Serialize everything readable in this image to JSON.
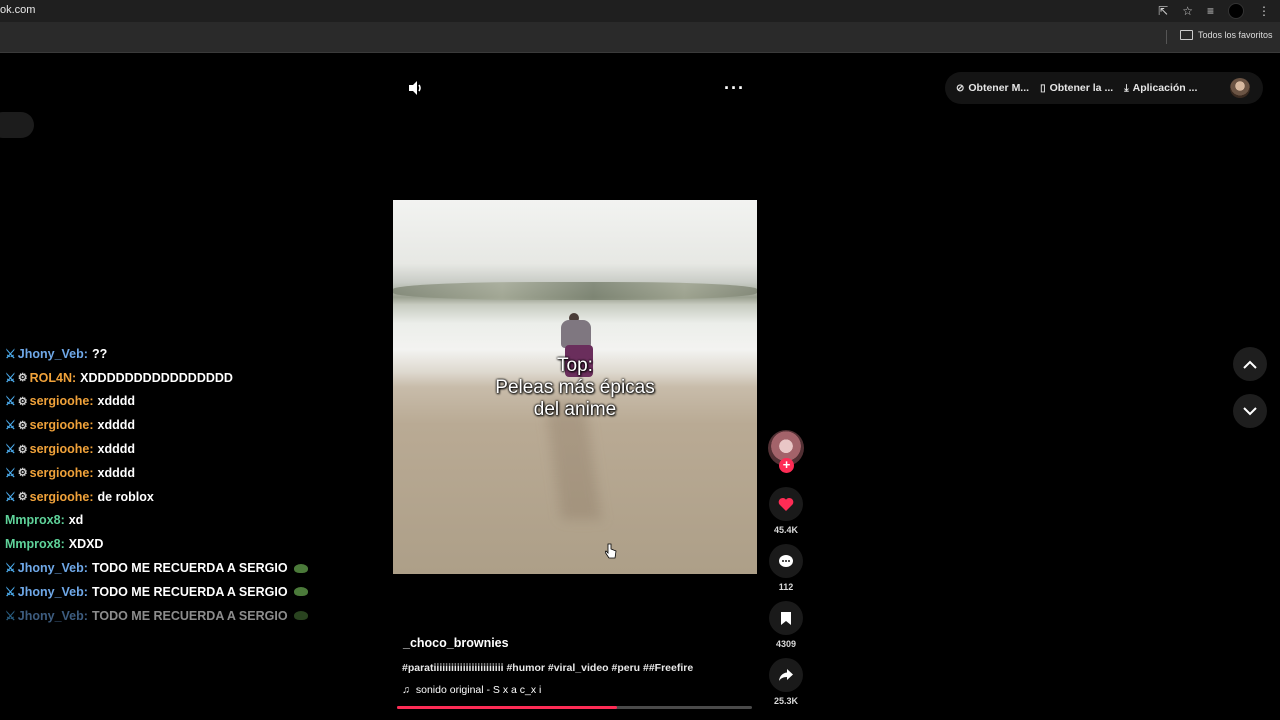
{
  "browser": {
    "url": "ok.com",
    "bookmark_folder": "Todos los favoritos"
  },
  "top_actions": [
    {
      "icon": "coin-icon",
      "label": "Obtener M..."
    },
    {
      "icon": "phone-icon",
      "label": "Obtener la ..."
    },
    {
      "icon": "download-icon",
      "label": "Aplicación ..."
    }
  ],
  "video": {
    "caption": [
      "Top:",
      "Peleas más épicas",
      "del anime"
    ],
    "progress_fraction": 0.62
  },
  "actions": {
    "likes": "45.4K",
    "comments": "112",
    "saves": "4309",
    "shares": "25.3K"
  },
  "post": {
    "author": "_choco_brownies",
    "description": "#paratiiiiiiiiiiiiiiiiiiiiiiii #humor #viral_video #peru ##Freefire",
    "sound": "sonido original - S x a c_x i"
  },
  "chat": [
    {
      "user": "Jhony_Veb:",
      "msg": "??",
      "color": "#6fa8e8",
      "badges": [
        "sword"
      ],
      "emote": false,
      "faded": false
    },
    {
      "user": "ROL4N:",
      "msg": "XDDDDDDDDDDDDDDDD",
      "color": "#f0a23a",
      "badges": [
        "sword",
        "globe"
      ],
      "emote": false,
      "faded": false
    },
    {
      "user": "sergioohe:",
      "msg": "xdddd",
      "color": "#f0a23a",
      "badges": [
        "sword",
        "globe"
      ],
      "emote": false,
      "faded": false
    },
    {
      "user": "sergioohe:",
      "msg": "xdddd",
      "color": "#f0a23a",
      "badges": [
        "sword",
        "globe"
      ],
      "emote": false,
      "faded": false
    },
    {
      "user": "sergioohe:",
      "msg": "xdddd",
      "color": "#f0a23a",
      "badges": [
        "sword",
        "globe"
      ],
      "emote": false,
      "faded": false
    },
    {
      "user": "sergioohe:",
      "msg": "xdddd",
      "color": "#f0a23a",
      "badges": [
        "sword",
        "globe"
      ],
      "emote": false,
      "faded": false
    },
    {
      "user": "sergioohe:",
      "msg": "de roblox",
      "color": "#f0a23a",
      "badges": [
        "sword",
        "globe"
      ],
      "emote": false,
      "faded": false
    },
    {
      "user": "Mmprox8:",
      "msg": "xd",
      "color": "#5fd39a",
      "badges": [],
      "emote": false,
      "faded": false
    },
    {
      "user": "Mmprox8:",
      "msg": "XDXD",
      "color": "#5fd39a",
      "badges": [],
      "emote": false,
      "faded": false
    },
    {
      "user": "Jhony_Veb:",
      "msg": "TODO ME RECUERDA A SERGIO",
      "color": "#6fa8e8",
      "badges": [
        "sword"
      ],
      "emote": true,
      "faded": false
    },
    {
      "user": "Jhony_Veb:",
      "msg": "TODO ME RECUERDA A SERGIO",
      "color": "#6fa8e8",
      "badges": [
        "sword"
      ],
      "emote": true,
      "faded": false
    },
    {
      "user": "Jhony_Veb:",
      "msg": "TODO ME RECUERDA A SERGIO",
      "color": "#6fa8e8",
      "badges": [
        "sword"
      ],
      "emote": true,
      "faded": true
    }
  ],
  "colors": {
    "accent": "#fe2c55",
    "background": "#000000"
  }
}
